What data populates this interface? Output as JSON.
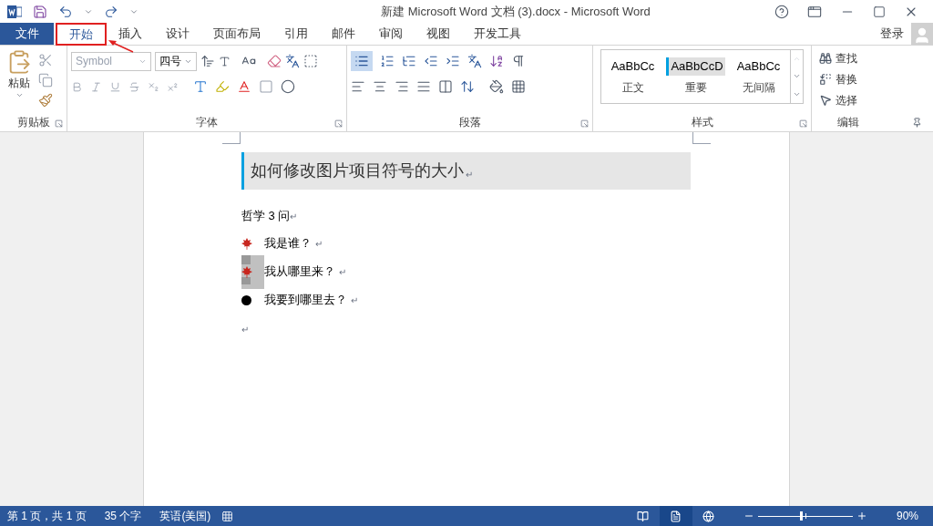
{
  "window": {
    "title": "新建 Microsoft Word 文档 (3).docx - Microsoft Word"
  },
  "file_tab": "文件",
  "tabs": [
    {
      "label": "开始",
      "selected": true
    },
    {
      "label": "插入",
      "selected": false
    },
    {
      "label": "设计",
      "selected": false
    },
    {
      "label": "页面布局",
      "selected": false
    },
    {
      "label": "引用",
      "selected": false
    },
    {
      "label": "邮件",
      "selected": false
    },
    {
      "label": "审阅",
      "selected": false
    },
    {
      "label": "视图",
      "selected": false
    },
    {
      "label": "开发工具",
      "selected": false
    }
  ],
  "sign_in": "登录",
  "ribbon": {
    "clipboard": {
      "paste": "粘贴",
      "label": "剪贴板"
    },
    "font": {
      "font_name": "Symbol",
      "font_size": "四号",
      "label": "字体"
    },
    "paragraph": {
      "label": "段落"
    },
    "styles": {
      "label": "样式",
      "items": [
        {
          "sample": "AaBbCc",
          "name": "正文",
          "selected": false
        },
        {
          "sample": "AaBbCcD",
          "name": "重要",
          "selected": true
        },
        {
          "sample": "AaBbCc",
          "name": "无间隔",
          "selected": false
        }
      ]
    },
    "editing": {
      "label": "编辑",
      "items": [
        "查找",
        "替换",
        "选择"
      ]
    }
  },
  "document": {
    "heading": "如何修改图片项目符号的大小",
    "mark": "↵",
    "intro": "哲学 3 问",
    "bullets": [
      {
        "kind": "leaf",
        "text": "我是谁？",
        "selected": false
      },
      {
        "kind": "leaf",
        "text": "我从哪里来？",
        "selected": true
      },
      {
        "kind": "dot",
        "text": "我要到哪里去？",
        "selected": false
      }
    ]
  },
  "status_bar": {
    "page": "第 1 页，共 1 页",
    "words": "35 个字",
    "language": "英语(美国)",
    "views": [
      {
        "kind": "read",
        "selected": false
      },
      {
        "kind": "print",
        "selected": true
      },
      {
        "kind": "web",
        "selected": false
      }
    ],
    "zoom": {
      "level": 0.45,
      "reading": "90%"
    }
  }
}
